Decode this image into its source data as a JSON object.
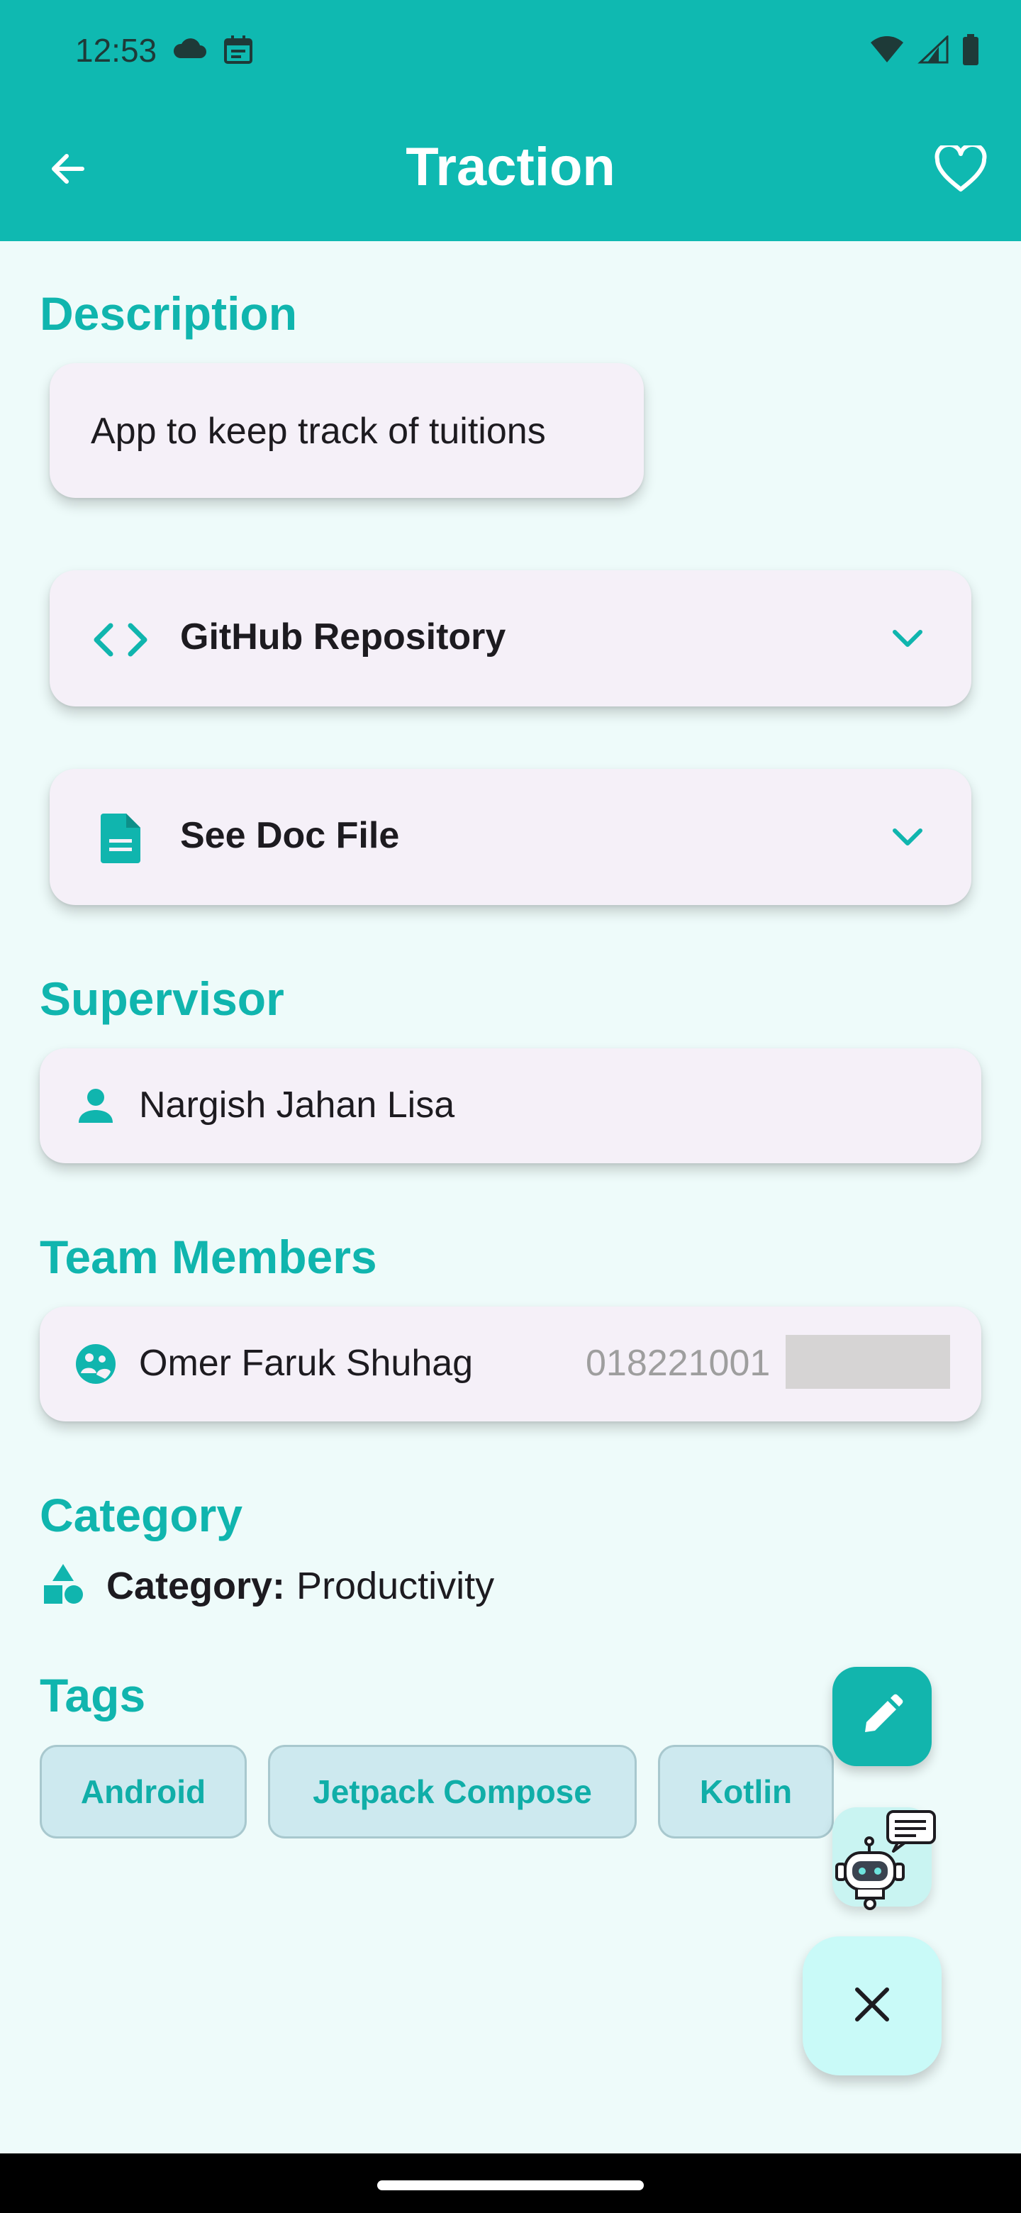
{
  "status_bar": {
    "time": "12:53",
    "left_icons": [
      "cloud-icon",
      "calendar-icon"
    ],
    "right_icons": [
      "wifi-icon",
      "signal-icon",
      "battery-icon"
    ]
  },
  "app_bar": {
    "title": "Traction",
    "back_icon": "arrow-back-icon",
    "favorite_icon": "heart-outline-icon"
  },
  "description": {
    "heading": "Description",
    "text": "App to keep track of tuitions"
  },
  "expandables": [
    {
      "label": "GitHub Repository",
      "icon": "code-icon"
    },
    {
      "label": "See Doc File",
      "icon": "document-icon"
    }
  ],
  "supervisor": {
    "heading": "Supervisor",
    "name": "Nargish Jahan Lisa"
  },
  "team": {
    "heading": "Team Members",
    "members": [
      {
        "name": "Omer Faruk Shuhag",
        "phone": "018221001"
      }
    ]
  },
  "category": {
    "heading": "Category",
    "key": "Category:",
    "value": "Productivity"
  },
  "tags": {
    "heading": "Tags",
    "items": [
      "Android",
      "Jetpack Compose",
      "Kotlin"
    ]
  },
  "colors": {
    "primary": "#0fb9b1",
    "background": "#eefbfa",
    "card": "#f5f0f8",
    "chip": "#cde9ef"
  }
}
